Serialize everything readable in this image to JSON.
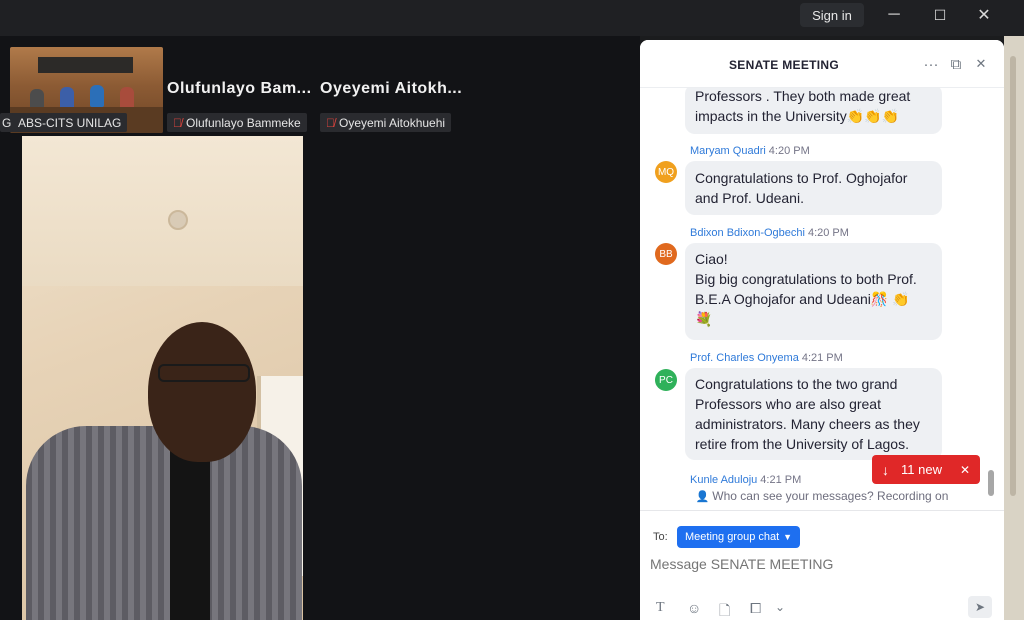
{
  "titlebar": {
    "signin_label": "Sign in",
    "minimize": "─",
    "maximize": "☐",
    "close": "✕"
  },
  "participants": [
    {
      "name": "Olufunlayo  Bam...",
      "tag": "Olufunlayo Bammeke"
    },
    {
      "name": "Oyeyemi  Aitokh...",
      "tag": "Oyeyemi Aitokhuehi"
    }
  ],
  "thumb_label": "ABS-CITS UNILAG",
  "left_edge_label": "G",
  "chat": {
    "title": "SENATE MEETING",
    "more_icon": "···",
    "popout_icon": "⧉",
    "close_icon": "✕",
    "messages": [
      {
        "sender": "",
        "time": "",
        "avatar": "",
        "text": [
          "Professors . They both made great",
          "impacts in the University👏👏👏"
        ]
      },
      {
        "sender": "Maryam Quadri",
        "time": "4:20 PM",
        "avatar": "MQ",
        "avatar_color": "#f0a01e",
        "text": [
          "Congratulations to Prof. Oghojafor",
          "and Prof. Udeani."
        ]
      },
      {
        "sender": "Bdixon Bdixon-Ogbechi",
        "time": "4:20 PM",
        "avatar": "BB",
        "avatar_color": "#e0691e",
        "text": [
          "Ciao!",
          "Big big congratulations to both Prof.",
          "B.E.A Oghojafor and Udeani🎊 👏",
          "💐"
        ]
      },
      {
        "sender": "Prof. Charles Onyema",
        "time": "4:21 PM",
        "avatar": "PC",
        "avatar_color": "#2fb15a",
        "text": [
          "Congratulations to the two grand",
          "Professors who are also great",
          "administrators. Many cheers as they",
          "retire from the University of Lagos."
        ]
      },
      {
        "sender": "Kunle Aduloju",
        "time": "4:21 PM",
        "avatar": "",
        "text": []
      }
    ],
    "new_pill": {
      "arrow": "↓",
      "label": "11 new",
      "close": "✕"
    },
    "privacy_text": "Who can see your messages? Recording on",
    "composer": {
      "to_label": "To:",
      "recipient": "Meeting group chat",
      "placeholder": "Message SENATE MEETING"
    },
    "tools": {
      "text": "T",
      "emoji": "☺",
      "file": "🗋",
      "screenshot": "⧠",
      "more": "⌄",
      "send": "➤"
    }
  }
}
